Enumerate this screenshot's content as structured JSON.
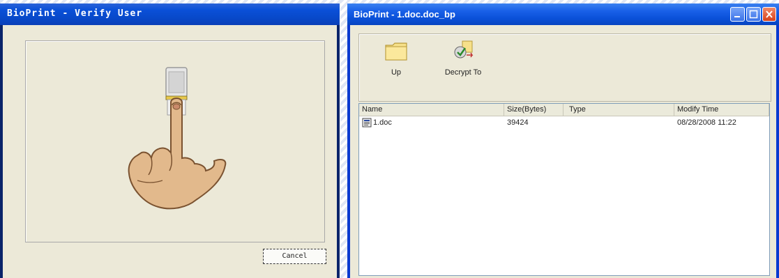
{
  "verify_window": {
    "title": "BioPrint - Verify User",
    "cancel_label": "Cancel"
  },
  "explorer_window": {
    "title": "BioPrint - 1.doc.doc_bp",
    "toolbar": {
      "up_label": "Up",
      "decrypt_label": "Decrypt To"
    },
    "columns": [
      "Name",
      "Size(Bytes)",
      "Type",
      "Modify Time"
    ],
    "files": [
      {
        "name": "1.doc",
        "size": "39424",
        "type": "",
        "modified": "08/28/2008 11:22",
        "icon": "word-doc-icon"
      }
    ]
  },
  "colors": {
    "titlebar_blue": "#0a50d8",
    "dialog_bg": "#ece9d8",
    "close_red": "#d8401a"
  }
}
